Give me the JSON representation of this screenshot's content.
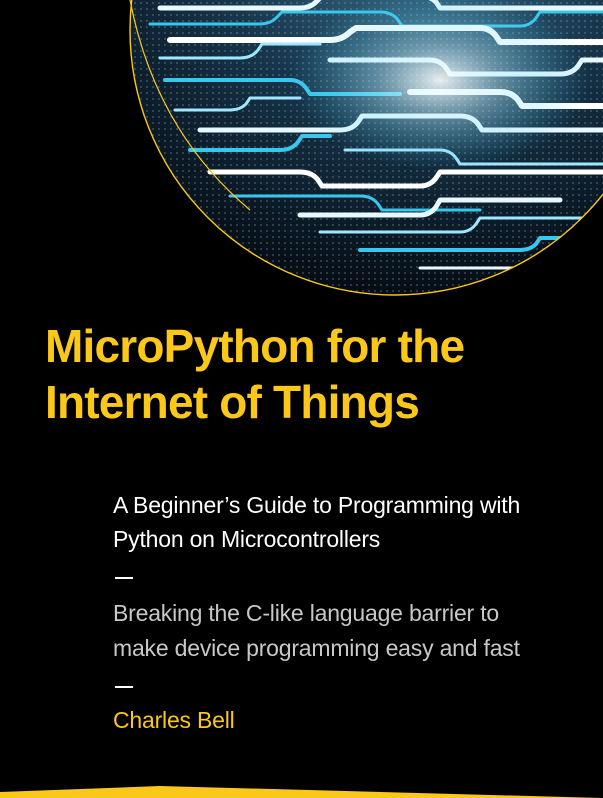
{
  "cover": {
    "title_lines": [
      "MicroPython for the",
      "Internet of Things"
    ],
    "subtitle_lines": [
      "A Beginner’s Guide to Programming with",
      "Python on Microcontrollers"
    ],
    "tagline_lines": [
      "Breaking the C-like language barrier to",
      "make device programming easy and fast"
    ],
    "author": "Charles Bell"
  },
  "colors": {
    "background": "#000000",
    "accent": "#fbc81a",
    "subtitle": "#ffffff",
    "tagline": "#c8c8c8",
    "glow": "#37c8ee"
  },
  "artwork": {
    "icon": "circuit-traces-image"
  }
}
